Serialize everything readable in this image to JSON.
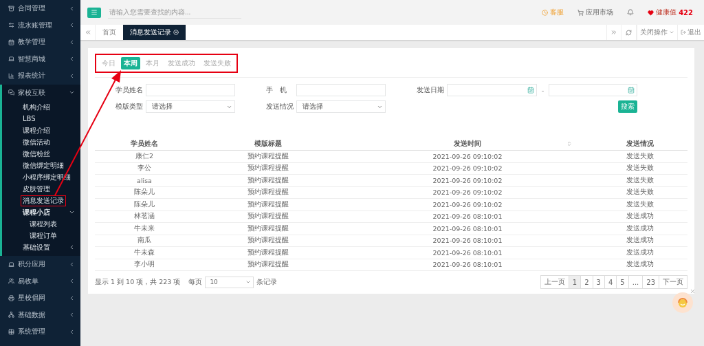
{
  "sidebar": {
    "items": [
      {
        "label": "合同管理",
        "expanded": false
      },
      {
        "label": "流水账管理",
        "expanded": false
      },
      {
        "label": "教学管理",
        "expanded": false
      },
      {
        "label": "智慧商城",
        "expanded": false
      },
      {
        "label": "报表统计",
        "expanded": false
      },
      {
        "label": "家校互联",
        "expanded": true,
        "children": [
          {
            "label": "机构介绍",
            "annotated": false
          },
          {
            "label": "LBS",
            "annotated": false
          },
          {
            "label": "课程介绍",
            "annotated": false
          },
          {
            "label": "微信活动",
            "annotated": false
          },
          {
            "label": "微信粉丝",
            "annotated": false
          },
          {
            "label": "微信绑定明细",
            "annotated": false
          },
          {
            "label": "小程序绑定明细",
            "annotated": false
          },
          {
            "label": "皮肤管理",
            "annotated": false
          },
          {
            "label": "消息发送记录",
            "annotated": true
          },
          {
            "label": "课程小店",
            "annotated": false,
            "expanded": true,
            "children": [
              {
                "label": "课程列表"
              },
              {
                "label": "课程订单"
              }
            ]
          },
          {
            "label": "基础设置",
            "annotated": false,
            "expanded": false
          }
        ]
      },
      {
        "label": "积分应用",
        "expanded": false
      },
      {
        "label": "易收单",
        "expanded": false
      },
      {
        "label": "星校倡网",
        "expanded": false
      },
      {
        "label": "基础数据",
        "expanded": false
      },
      {
        "label": "系统管理",
        "expanded": false
      }
    ]
  },
  "topbar": {
    "search": {
      "placeholder": "请输入您需要查找的内容..."
    },
    "service": "客服",
    "market": "应用市场",
    "health": {
      "label": "健康值",
      "value": "422"
    }
  },
  "page_tabs": {
    "tabs": [
      {
        "label": "首页",
        "selected": false
      },
      {
        "label": "消息发送记录",
        "selected": true
      }
    ],
    "close_menu": "关闭操作",
    "logout": "退出"
  },
  "quick_filters": {
    "annotated": true,
    "items": [
      {
        "label": "今日",
        "selected": false
      },
      {
        "label": "本周",
        "selected": true
      },
      {
        "label": "本月",
        "selected": false
      },
      {
        "label": "发送成功",
        "selected": false
      },
      {
        "label": "发送失败",
        "selected": false
      }
    ]
  },
  "form": {
    "student_name": {
      "label": "学员姓名"
    },
    "phone": {
      "label": "手　机"
    },
    "send_date": {
      "label": "发送日期",
      "separator": "-"
    },
    "template_type": {
      "label": "模版类型",
      "value": "请选择"
    },
    "send_status": {
      "label": "发送情况",
      "value": "请选择"
    },
    "search_button": "搜索"
  },
  "table": {
    "columns": [
      "学员姓名",
      "模版标题",
      "发送时间",
      "发送情况"
    ],
    "rows": [
      [
        "康仁2",
        "预约课程提醒",
        "2021-09-26 09:10:02",
        "发送失败"
      ],
      [
        "李公",
        "预约课程提醒",
        "2021-09-26 09:10:02",
        "发送失败"
      ],
      [
        "alisa",
        "预约课程提醒",
        "2021-09-26 09:10:02",
        "发送失败"
      ],
      [
        "陈朵儿",
        "预约课程提醒",
        "2021-09-26 09:10:02",
        "发送失败"
      ],
      [
        "陈朵儿",
        "预约课程提醒",
        "2021-09-26 09:10:02",
        "发送失败"
      ],
      [
        "林茗涵",
        "预约课程提醒",
        "2021-09-26 08:10:01",
        "发送成功"
      ],
      [
        "牛未来",
        "预约课程提醒",
        "2021-09-26 08:10:01",
        "发送成功"
      ],
      [
        "南瓜",
        "预约课程提醒",
        "2021-09-26 08:10:01",
        "发送成功"
      ],
      [
        "牛未森",
        "预约课程提醒",
        "2021-09-26 08:10:01",
        "发送成功"
      ],
      [
        "李小明",
        "预约课程提醒",
        "2021-09-26 08:10:01",
        "发送成功"
      ]
    ]
  },
  "pagination": {
    "info": "显示 1 到 10 项，共 223 项",
    "per_page_label": "每页",
    "per_page": "10",
    "per_page_suffix": "条记录",
    "pages": [
      {
        "label": "上一页",
        "selected": false
      },
      {
        "label": "1",
        "selected": true
      },
      {
        "label": "2",
        "selected": false
      },
      {
        "label": "3",
        "selected": false
      },
      {
        "label": "4",
        "selected": false
      },
      {
        "label": "5",
        "selected": false
      },
      {
        "label": "...",
        "selected": false
      },
      {
        "label": "23",
        "selected": false
      },
      {
        "label": "下一页",
        "selected": false
      }
    ]
  }
}
